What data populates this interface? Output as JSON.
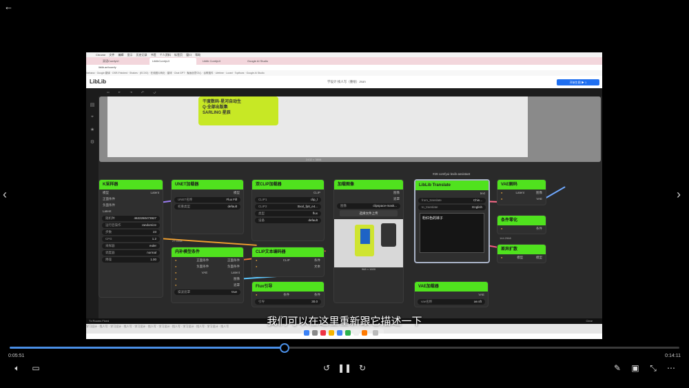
{
  "player": {
    "subtitle": "我们可以在这里重新跟它描述一下",
    "time_current": "0:05:51",
    "time_total": "0:14:11",
    "progress": 0.41
  },
  "browser": {
    "menu": [
      "Chrome",
      "文件",
      "编辑",
      "显示",
      "历史记录",
      "书签",
      "个人资料",
      "标签页",
      "窗口",
      "帮助"
    ],
    "tabs": [
      "双语ComfyUI",
      "LiblibComfyUI",
      "Liblib ComfyUI",
      "Google AI Studio"
    ],
    "url": "liblib.art/comfy",
    "bookmarks": "Ikebana · Google 翻译 · OSR-Finished · Shakes · (ECOG) · 在线图片转化 · 星球 · Chat GPT · 聚画创意中心 · 谷歌插件 · Lifetime · Lovart · Topflows · Google AI Studio"
  },
  "app": {
    "logo": "LibLib",
    "title": "学设计 找人写（重绘）Json",
    "run_label": "开始生图 ▶ 1"
  },
  "preview": {
    "caption": "2432 × 3808",
    "sticker_lines": [
      "干度数码·星河自动生",
      "Q·全部出版集",
      "SARLING 星辰"
    ]
  },
  "nodes": {
    "ksampler": {
      "title": "K采样器",
      "id": "#3",
      "io_left": [
        "模型",
        "正面条件",
        "负面条件",
        "Latent"
      ],
      "out": "Latent",
      "fields": [
        {
          "label": "随机种",
          "value": "4622260473927"
        },
        {
          "label": "运行后操作",
          "value": "randomize"
        },
        {
          "label": "步数",
          "value": "23"
        },
        {
          "label": "CFG",
          "value": "1.2"
        },
        {
          "label": "采样器",
          "value": "euler"
        },
        {
          "label": "调度器",
          "value": "normal"
        },
        {
          "label": "降噪",
          "value": "1.00"
        }
      ]
    },
    "unet": {
      "title": "UNET加载器",
      "id": "#12",
      "out": "模型",
      "fields": [
        {
          "label": "UNET名称",
          "value": "Flux Fill"
        },
        {
          "label": "权重类型",
          "value": "default"
        }
      ]
    },
    "dualclip": {
      "title": "双CLIP加载器",
      "id": "#11",
      "out": "CLIP",
      "fields": [
        {
          "label": "CLIP1",
          "value": "clip_l"
        },
        {
          "label": "CLIP2",
          "value": "t5xxl_fp8_e4..."
        },
        {
          "label": "类型",
          "value": "flux"
        },
        {
          "label": "设备",
          "value": "default"
        }
      ]
    },
    "loadimage": {
      "title": "加载图像",
      "id": "#28",
      "outs": [
        "图像",
        "遮罩"
      ],
      "field": {
        "label": "图像",
        "value": "clipspace-mask..."
      },
      "button": "选择文件上传",
      "img_caption": "968 × 1600"
    },
    "translate": {
      "header_top": "#29 comfyui-lexib-assistant",
      "title": "LibLib Translate",
      "out": "text",
      "fields": [
        {
          "label": "from_translate",
          "value": "Chin..."
        },
        {
          "label": "to_translate",
          "value": "English"
        }
      ],
      "text": "粉红色的袜子"
    },
    "vaedecode": {
      "title": "VAE解码",
      "id": "#8",
      "ins": [
        "Latent",
        "VAE"
      ],
      "out": "图像"
    },
    "condzero": {
      "title": "条件零化",
      "id": "#13",
      "ins": [
        "条件"
      ],
      "note": "144.2968"
    },
    "diffexpand": {
      "title": "差异扩散",
      "id": "#25",
      "ins": [
        "模型"
      ],
      "out": "模型"
    },
    "inpaint": {
      "title": "内补模型条件",
      "id": "#18",
      "note": "27.4448",
      "ins": [
        "正面条件",
        "负面条件",
        "VAE",
        "图像",
        "遮罩"
      ],
      "outs": [
        "正面条件",
        "负面条件",
        "Latent"
      ],
      "field": {
        "label": "噪波遮罩",
        "value": "true"
      }
    },
    "cliptext": {
      "title": "CLIP文本编码器",
      "id": "#26",
      "ins": [
        "CLIP",
        "文本"
      ],
      "out": "条件"
    },
    "fluxguide": {
      "title": "Flux引导",
      "id": "#21",
      "ins": [
        "条件"
      ],
      "out": "条件",
      "field": {
        "label": "引导",
        "value": "30.0"
      }
    },
    "vaeloader": {
      "title": "VAE加载器",
      "id": "#14",
      "out": "VAE",
      "field": {
        "label": "vae名称",
        "value": "ae.sft"
      }
    }
  },
  "status": {
    "left": "Tx Rooms Fixed",
    "right": "Clear"
  },
  "banner": "学习设计 · 找人写 · 学习设计 · 找人写 · 学习设计 · 找人写 · 学习设计 · 找人写 · 学习设计 · 找人写 · 学习设计 · 找人写",
  "colors": {
    "accent": "#50e21e",
    "player_accent": "#4a8fe7"
  }
}
